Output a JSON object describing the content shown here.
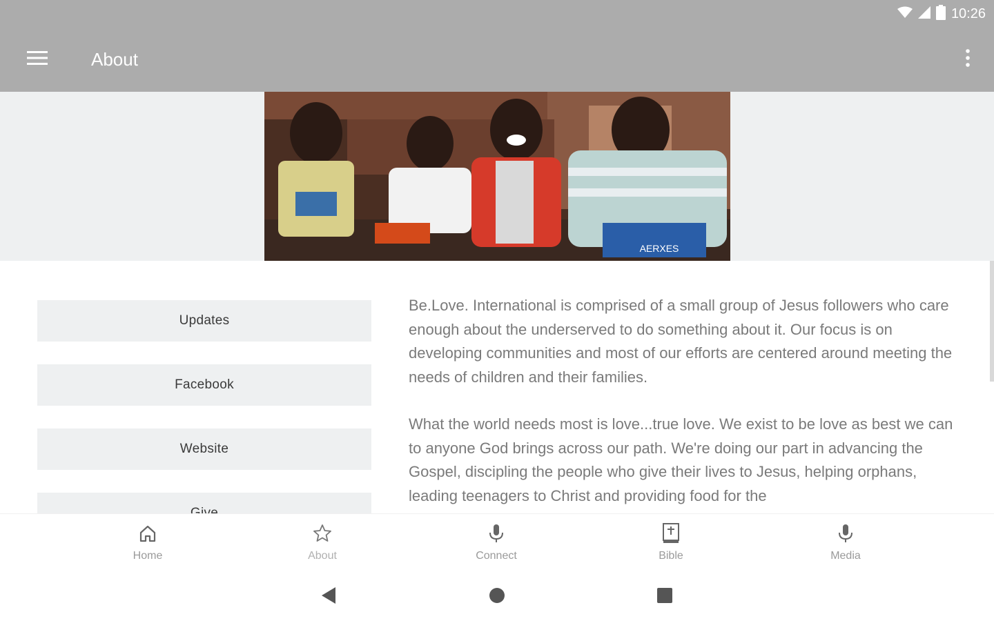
{
  "status_bar": {
    "time": "10:26",
    "icons": [
      "wifi-icon",
      "signal-icon",
      "battery-icon"
    ]
  },
  "app_bar": {
    "title": "About",
    "menu_icon": "hamburger-menu-icon",
    "overflow_icon": "more-vert-icon"
  },
  "hero": {
    "image_description_icon": "children-photo",
    "caption_on_box": "AERXES"
  },
  "buttons": [
    {
      "label": "Updates"
    },
    {
      "label": "Facebook"
    },
    {
      "label": "Website"
    },
    {
      "label": "Give"
    }
  ],
  "about": {
    "paragraphs": [
      "Be.Love. International is comprised of a small group of Jesus followers who care enough about the underserved to do something about it. Our focus is on developing communities and most of our efforts are centered around meeting the needs of children and their families.",
      "What the world needs most is love...true love. We exist to be love as best we can to anyone God brings across our path. We're doing our part in advancing the Gospel, discipling the people who give their lives to Jesus, helping orphans, leading teenagers to Christ and providing food for the"
    ]
  },
  "bottom_nav": {
    "items": [
      {
        "label": "Home",
        "icon": "home-icon"
      },
      {
        "label": "About",
        "icon": "star-icon"
      },
      {
        "label": "Connect",
        "icon": "microphone-icon"
      },
      {
        "label": "Bible",
        "icon": "bible-icon"
      },
      {
        "label": "Media",
        "icon": "microphone-icon"
      }
    ]
  },
  "system_nav": {
    "items": [
      "back-icon",
      "home-circle-icon",
      "recents-icon"
    ]
  },
  "colors": {
    "app_bar": "#acacac",
    "hero_band": "#eef0f1",
    "button_bg": "#eef0f1",
    "body_text": "#7a7a7a",
    "nav_label": "#9a9a9a"
  }
}
